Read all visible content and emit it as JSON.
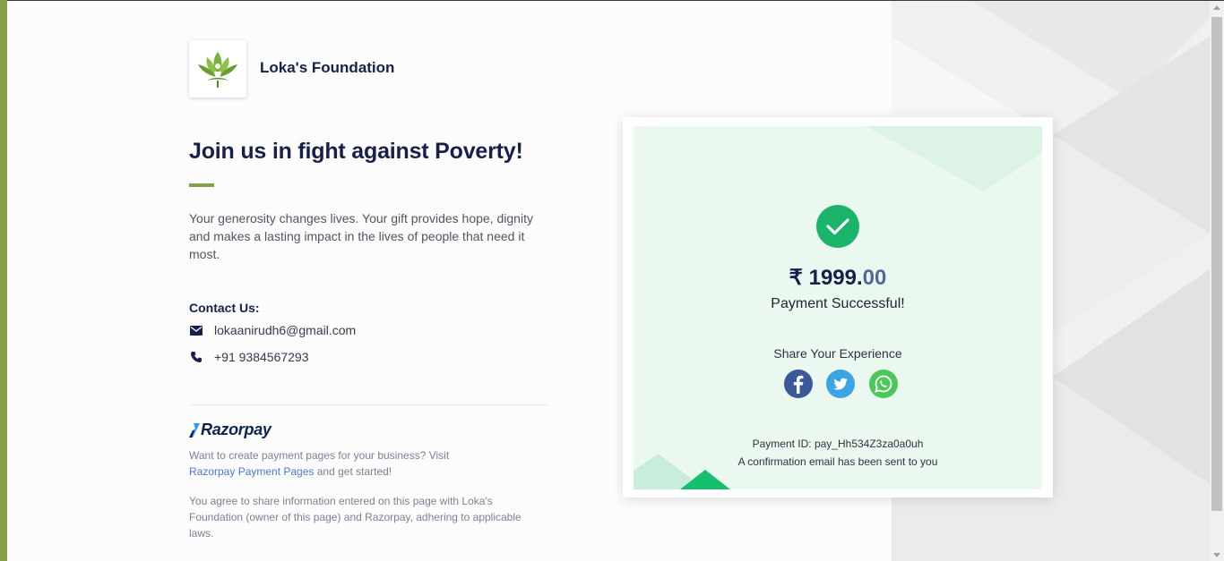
{
  "brand": {
    "name": "Loka's Foundation",
    "logo_icon": "lotus-logo",
    "accent_color": "#84a04a"
  },
  "page": {
    "headline": "Join us in fight against Poverty!",
    "description": "Your generosity changes lives. Your gift provides hope, dignity and makes a lasting impact in the lives of people that need it most."
  },
  "contact": {
    "title": "Contact Us:",
    "email": "lokaanirudh6@gmail.com",
    "phone": "+91 9384567293",
    "email_icon": "mail-icon",
    "phone_icon": "phone-icon"
  },
  "razorpay": {
    "logo_text": "Razorpay",
    "promo_text": "Want to create payment pages for your business? Visit",
    "promo_link": "Razorpay Payment Pages",
    "promo_suffix": " and get started!",
    "disclaimer": "You agree to share information entered on this page with Loka's Foundation (owner of this page) and Razorpay, adhering to applicable laws."
  },
  "payment": {
    "currency": "₹",
    "amount_whole": "1999.",
    "amount_decimal": "00",
    "status": "Payment Successful!",
    "share_title": "Share Your Experience",
    "payment_id": "Payment ID: pay_Hh534Z3za0a0uh",
    "confirmation": "A confirmation email has been sent to you",
    "success_color": "#1ab56b"
  },
  "social": [
    {
      "name": "facebook",
      "icon": "facebook-icon",
      "color": "#3b5998"
    },
    {
      "name": "twitter",
      "icon": "twitter-icon",
      "color": "#1da1f2"
    },
    {
      "name": "whatsapp",
      "icon": "whatsapp-icon",
      "color": "#25d366"
    }
  ]
}
